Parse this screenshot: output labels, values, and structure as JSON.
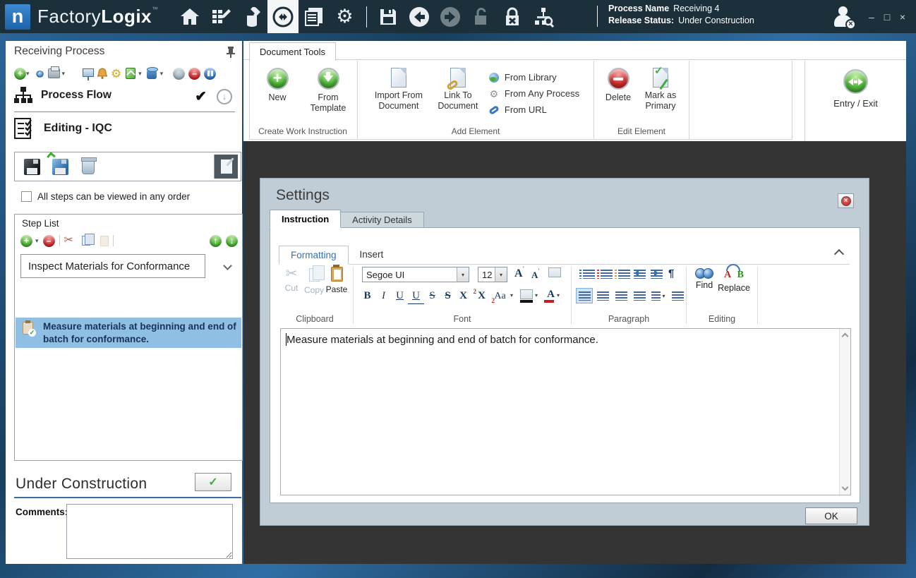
{
  "colors": {
    "titlebar_bg": "#1c303c",
    "logo_blue": "#2277c4",
    "frame_blue": "#2f6ea5",
    "canvas_dark": "#343434",
    "dialog_bg": "#c1cdd6",
    "selection_blue": "#8fc0e4",
    "accent_green": "#3fae3f",
    "accent_red": "#cc2222",
    "formatting_link_blue": "#2d74b5"
  },
  "glyphs": {
    "caret": "▾",
    "plus": "+",
    "minus": "–",
    "check": "✔",
    "check_light": "✓",
    "up": "↑",
    "down": "↓",
    "scissors": "✂",
    "gear": "⚙",
    "pilcrow": "¶",
    "close_x": "×",
    "minimize": "–",
    "maximize": "□",
    "logo_letter": "n",
    "person_x": "×"
  },
  "titlebar": {
    "brand_factory": "Factory",
    "brand_logix": "Logix",
    "brand_tm": "™",
    "process_name_label": "Process Name",
    "process_name_value": "Receiving 4",
    "release_status_label": "Release Status:",
    "release_status_value": "Under Construction"
  },
  "left_panel": {
    "title": "Receiving Process",
    "process_flow_label": "Process Flow",
    "section_label": "Editing - IQC",
    "any_order_label": "All steps can be viewed in any order",
    "step_list": {
      "title": "Step List",
      "selected_step": "Inspect Materials for Conformance",
      "steps": [
        {
          "text": "Measure materials at beginning and end of batch for conformance."
        }
      ]
    },
    "status_heading": "Under Construction",
    "comments_label": "Comments:",
    "comments_value": ""
  },
  "ribbon": {
    "tab_label": "Document Tools",
    "new_label": "New",
    "from_template_label": "From Template",
    "import_from_document_label": "Import From Document",
    "link_to_document_label": "Link To Document",
    "from_library_label": "From Library",
    "from_any_process_label": "From Any Process",
    "from_url_label": "From URL",
    "delete_label": "Delete",
    "mark_as_primary_label": "Mark as Primary",
    "group_create_label": "Create Work Instruction",
    "group_add_label": "Add Element",
    "group_edit_label": "Edit Element",
    "entry_exit_label": "Entry / Exit"
  },
  "dialog": {
    "title": "Settings",
    "tab_instruction": "Instruction",
    "tab_activity": "Activity Details",
    "tab_formatting": "Formatting",
    "tab_insert": "Insert",
    "clipboard_group": "Clipboard",
    "cut_label": "Cut",
    "copy_label": "Copy",
    "paste_label": "Paste",
    "font_group": "Font",
    "font_family": "Segoe UI",
    "font_size": "12",
    "glyph_bold": "B",
    "glyph_italic": "I",
    "glyph_underline": "U",
    "glyph_dbl_underline": "U",
    "glyph_strike": "S",
    "glyph_dbl_strike": "S",
    "glyph_superscript": "X",
    "glyph_subscript": "X",
    "glyph_sup_mark": "2",
    "glyph_sub_mark": "2",
    "glyph_case": "Aa",
    "glyph_grow": "A",
    "glyph_shrink": "A",
    "glyph_color": "A",
    "paragraph_group": "Paragraph",
    "editing_group": "Editing",
    "find_label": "Find",
    "replace_label": "Replace",
    "replace_a": "A",
    "replace_b": "B",
    "editor_text": "Measure materials at beginning and end of batch for conformance.",
    "ok_label": "OK"
  }
}
